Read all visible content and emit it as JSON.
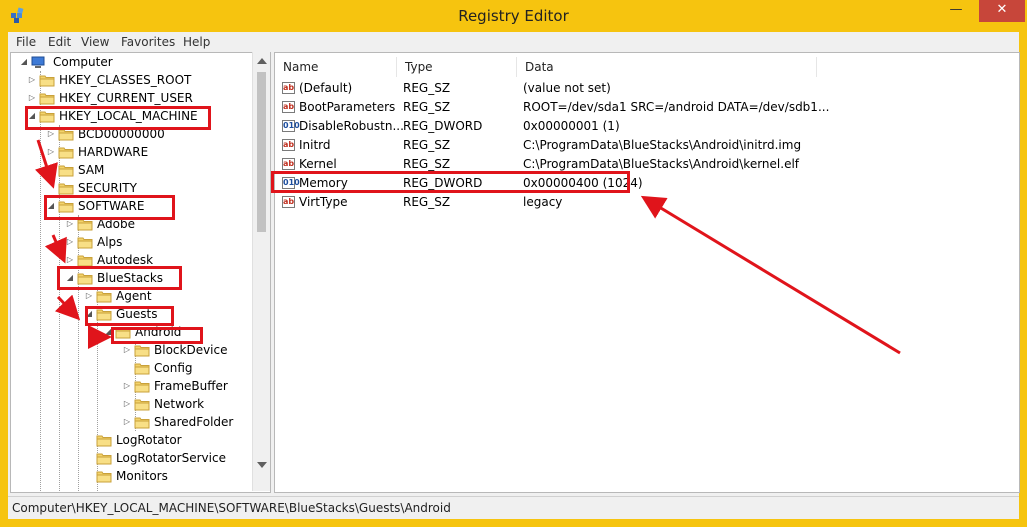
{
  "window": {
    "title": "Registry Editor",
    "min": "—",
    "max": "□",
    "close": "✕"
  },
  "menu": [
    "File",
    "Edit",
    "View",
    "Favorites",
    "Help"
  ],
  "tree": {
    "root": "Computer",
    "nodes": [
      {
        "label": "HKEY_CLASSES_ROOT"
      },
      {
        "label": "HKEY_CURRENT_USER"
      },
      {
        "label": "HKEY_LOCAL_MACHINE"
      },
      {
        "label": "BCD00000000"
      },
      {
        "label": "HARDWARE"
      },
      {
        "label": "SAM"
      },
      {
        "label": "SECURITY"
      },
      {
        "label": "SOFTWARE"
      },
      {
        "label": "Adobe"
      },
      {
        "label": "Alps"
      },
      {
        "label": "Autodesk"
      },
      {
        "label": "BlueStacks"
      },
      {
        "label": "Agent"
      },
      {
        "label": "Guests"
      },
      {
        "label": "Android"
      },
      {
        "label": "BlockDevice"
      },
      {
        "label": "Config"
      },
      {
        "label": "FrameBuffer"
      },
      {
        "label": "Network"
      },
      {
        "label": "SharedFolder"
      },
      {
        "label": "LogRotator"
      },
      {
        "label": "LogRotatorService"
      },
      {
        "label": "Monitors"
      }
    ]
  },
  "list": {
    "columns": [
      "Name",
      "Type",
      "Data"
    ],
    "rows": [
      {
        "name": "(Default)",
        "type": "REG_SZ",
        "data": "(value not set)",
        "icon": "ab"
      },
      {
        "name": "BootParameters",
        "type": "REG_SZ",
        "data": "ROOT=/dev/sda1 SRC=/android DATA=/dev/sdb1...",
        "icon": "ab"
      },
      {
        "name": "DisableRobustn...",
        "type": "REG_DWORD",
        "data": "0x00000001 (1)",
        "icon": "010"
      },
      {
        "name": "Initrd",
        "type": "REG_SZ",
        "data": "C:\\ProgramData\\BlueStacks\\Android\\initrd.img",
        "icon": "ab"
      },
      {
        "name": "Kernel",
        "type": "REG_SZ",
        "data": "C:\\ProgramData\\BlueStacks\\Android\\kernel.elf",
        "icon": "ab"
      },
      {
        "name": "Memory",
        "type": "REG_DWORD",
        "data": "0x00000400 (1024)",
        "icon": "010"
      },
      {
        "name": "VirtType",
        "type": "REG_SZ",
        "data": "legacy",
        "icon": "ab"
      }
    ]
  },
  "status": "Computer\\HKEY_LOCAL_MACHINE\\SOFTWARE\\BlueStacks\\Guests\\Android",
  "colors": {
    "annotation": "#e0141b",
    "frame": "#f6c40f",
    "close": "#c7463a"
  }
}
